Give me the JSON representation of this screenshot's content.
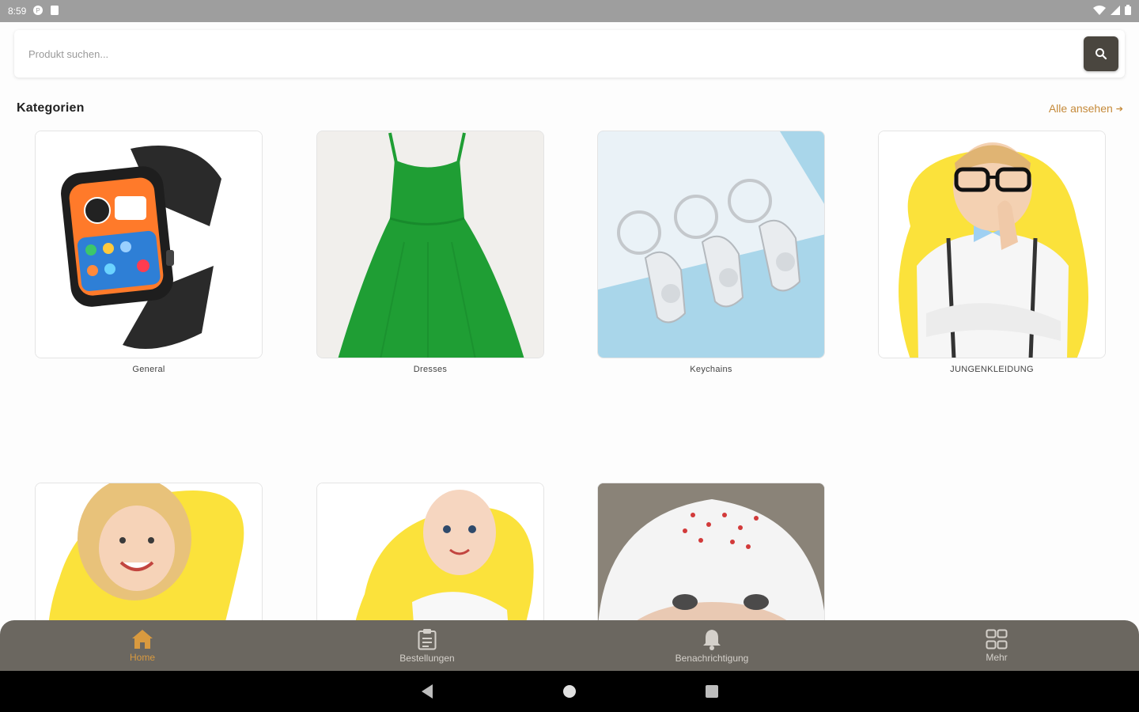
{
  "status_bar": {
    "time": "8:59"
  },
  "search": {
    "placeholder": "Produkt suchen..."
  },
  "categories_section": {
    "title": "Kategorien",
    "view_all_label": "Alle ansehen",
    "view_all_arrow": "➔"
  },
  "categories": [
    {
      "label": "General",
      "icon": "smartwatch-image"
    },
    {
      "label": "Dresses",
      "icon": "green-dress-image"
    },
    {
      "label": "Keychains",
      "icon": "keychains-image"
    },
    {
      "label": "JUNGENKLEIDUNG",
      "icon": "boy-clothing-image"
    },
    {
      "label": "",
      "icon": "girl-clothing-image"
    },
    {
      "label": "",
      "icon": "baby-clothing-image"
    },
    {
      "label": "",
      "icon": "baby-hat-image"
    }
  ],
  "bottom_nav": {
    "items": [
      {
        "label": "Home",
        "icon": "home-icon",
        "active": true
      },
      {
        "label": "Bestellungen",
        "icon": "clipboard-icon",
        "active": false
      },
      {
        "label": "Benachrichtigung",
        "icon": "bell-icon",
        "active": false
      },
      {
        "label": "Mehr",
        "icon": "grid-icon",
        "active": false
      }
    ]
  },
  "colors": {
    "accent": "#d99a3f",
    "nav_bg": "#6b6760",
    "search_button": "#4a463f",
    "link": "#c58a3a"
  }
}
